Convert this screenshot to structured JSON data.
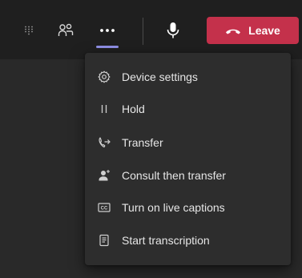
{
  "toolbar": {
    "leave_label": "Leave",
    "icons": [
      "dialpad-icon",
      "people-icon",
      "more-options-icon",
      "microphone-icon",
      "phone-hangup-icon"
    ],
    "leave_color": "#c4314b",
    "active_indicator_color": "#8f8fe6"
  },
  "menu": {
    "items": [
      {
        "label": "Device settings",
        "icon": "gear-icon"
      },
      {
        "label": "Hold",
        "icon": "pause-icon"
      },
      {
        "label": "Transfer",
        "icon": "transfer-icon"
      },
      {
        "label": "Consult then transfer",
        "icon": "consult-transfer-icon"
      },
      {
        "label": "Turn on live captions",
        "icon": "closed-captions-icon"
      },
      {
        "label": "Start transcription",
        "icon": "transcript-icon"
      }
    ]
  }
}
